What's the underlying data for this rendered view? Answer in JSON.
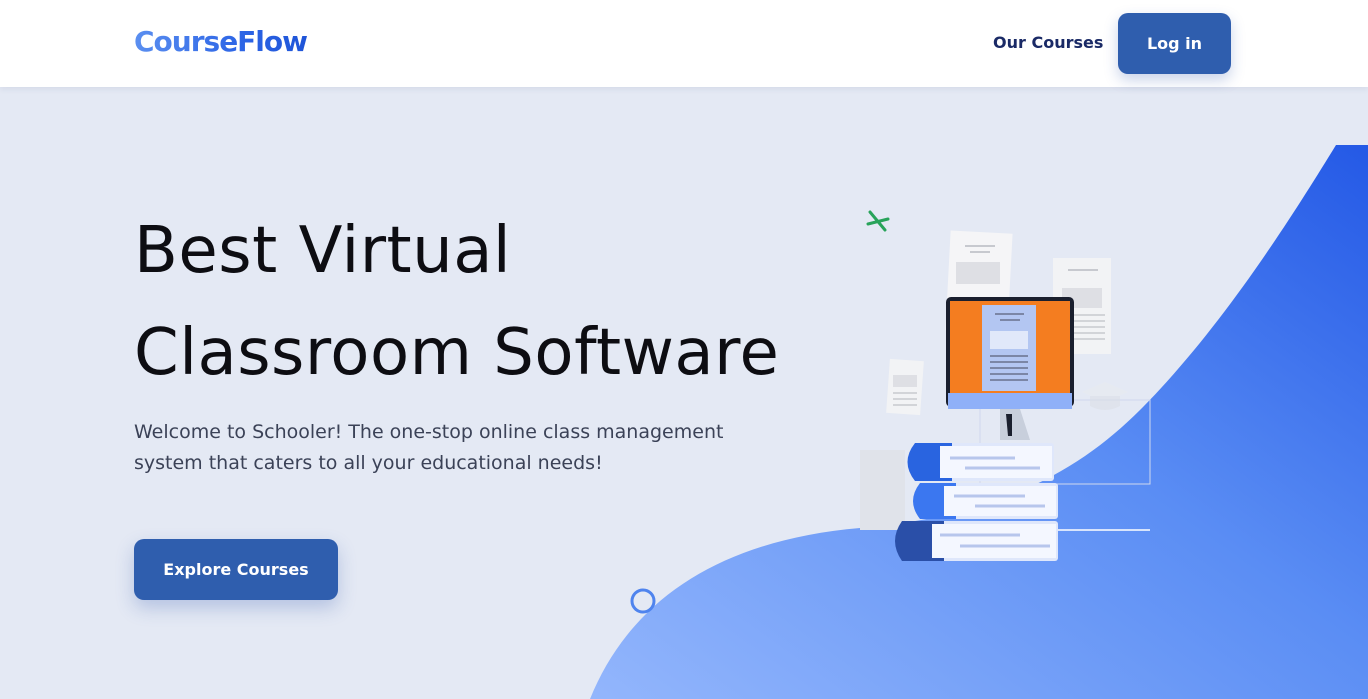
{
  "header": {
    "logo_text": "CourseFlow",
    "nav_link": "Our Courses",
    "login_label": "Log in"
  },
  "hero": {
    "title_line1": "Best Virtual",
    "title_line2": "Classroom Software",
    "subtitle": "Welcome to Schooler! The one-stop online class management system that caters to all your educational needs!",
    "cta_label": "Explore Courses"
  },
  "colors": {
    "page_bg": "#e4e9f4",
    "brand_blue": "#2f5eae",
    "nav_text": "#1a2a66",
    "wave_light": "#8fb2fb",
    "wave_dark": "#2a62ea",
    "screen_orange": "#f47d20"
  },
  "illustration": {
    "description_icons": [
      "computer-icon",
      "books-icon",
      "documents-icon",
      "graduation-cap-icon",
      "sparkle-icon"
    ]
  }
}
